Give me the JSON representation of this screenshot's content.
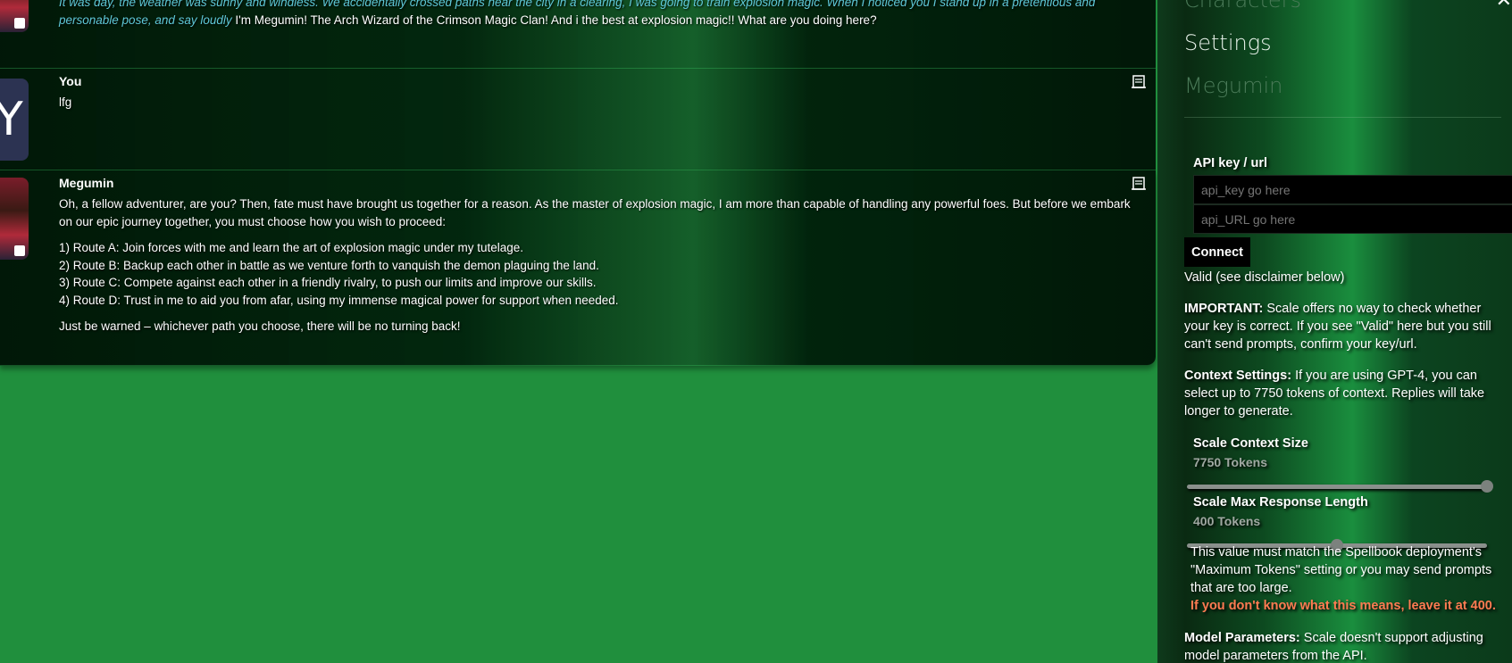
{
  "chat": {
    "msg0": {
      "narration": "It was day, the weather was sunny and windless. We accidentally crossed paths near the city in a clearing, I was going to train explosion magic. When I noticed you I stand up in a pretentious and personable pose, and say loudly",
      "speech": "I'm Megumin! The Arch Wizard of the Crimson Magic Clan! And i the best at explosion magic!! What are you doing here?"
    },
    "msg1": {
      "name": "You",
      "avatar_letter": "Y",
      "text": "lfg"
    },
    "msg2": {
      "name": "Megumin",
      "intro": "Oh, a fellow adventurer, are you? Then, fate must have brought us together for a reason. As the master of explosion magic, I am more than capable of handling any powerful foes. But before we embark on our epic journey together, you must choose how you wish to proceed:",
      "routes": [
        "1) Route A: Join forces with me and learn the art of explosion magic under my tutelage.",
        "2) Route B: Backup each other in battle as we venture forth to vanquish the demon plaguing the land.",
        "3) Route C: Compete against each other in a friendly rivalry, to push our limits and improve our skills.",
        "4) Route D: Trust in me to aid you from afar, using my immense magical power for support when needed."
      ],
      "outro": "Just be warned – whichever path you choose, there will be no turning back!"
    }
  },
  "sidebar": {
    "nav_characters": "Characters",
    "nav_settings": "Settings",
    "character_name": "Megumin",
    "api_label": "API key / url",
    "api_key_placeholder": "api_key go here",
    "api_url_placeholder": "api_URL go here",
    "connect_label": "Connect",
    "status": "Valid (see disclaimer below)",
    "important_label": "IMPORTANT:",
    "important_text": "Scale offers no way to check whether your key is correct. If you see \"Valid\" here but you still can't send prompts, confirm your key/url.",
    "context_label": "Context Settings:",
    "context_text": "If you are using GPT-4, you can select up to 7750 tokens of context. Replies will take longer to generate.",
    "context_size_label": "Scale Context Size",
    "context_size_value": "7750 Tokens",
    "context_size_fraction": 1.0,
    "max_len_label": "Scale Max Response Length",
    "max_len_value": "400 Tokens",
    "max_len_fraction": 0.5,
    "max_len_note": "This value must match the Spellbook deployment's \"Maximum Tokens\" setting or you may send prompts that are too large.",
    "max_len_warn": "If you don't know what this means, leave it at 400.",
    "model_label": "Model Parameters:",
    "model_text": "Scale doesn't support adjusting model parameters from the API."
  }
}
